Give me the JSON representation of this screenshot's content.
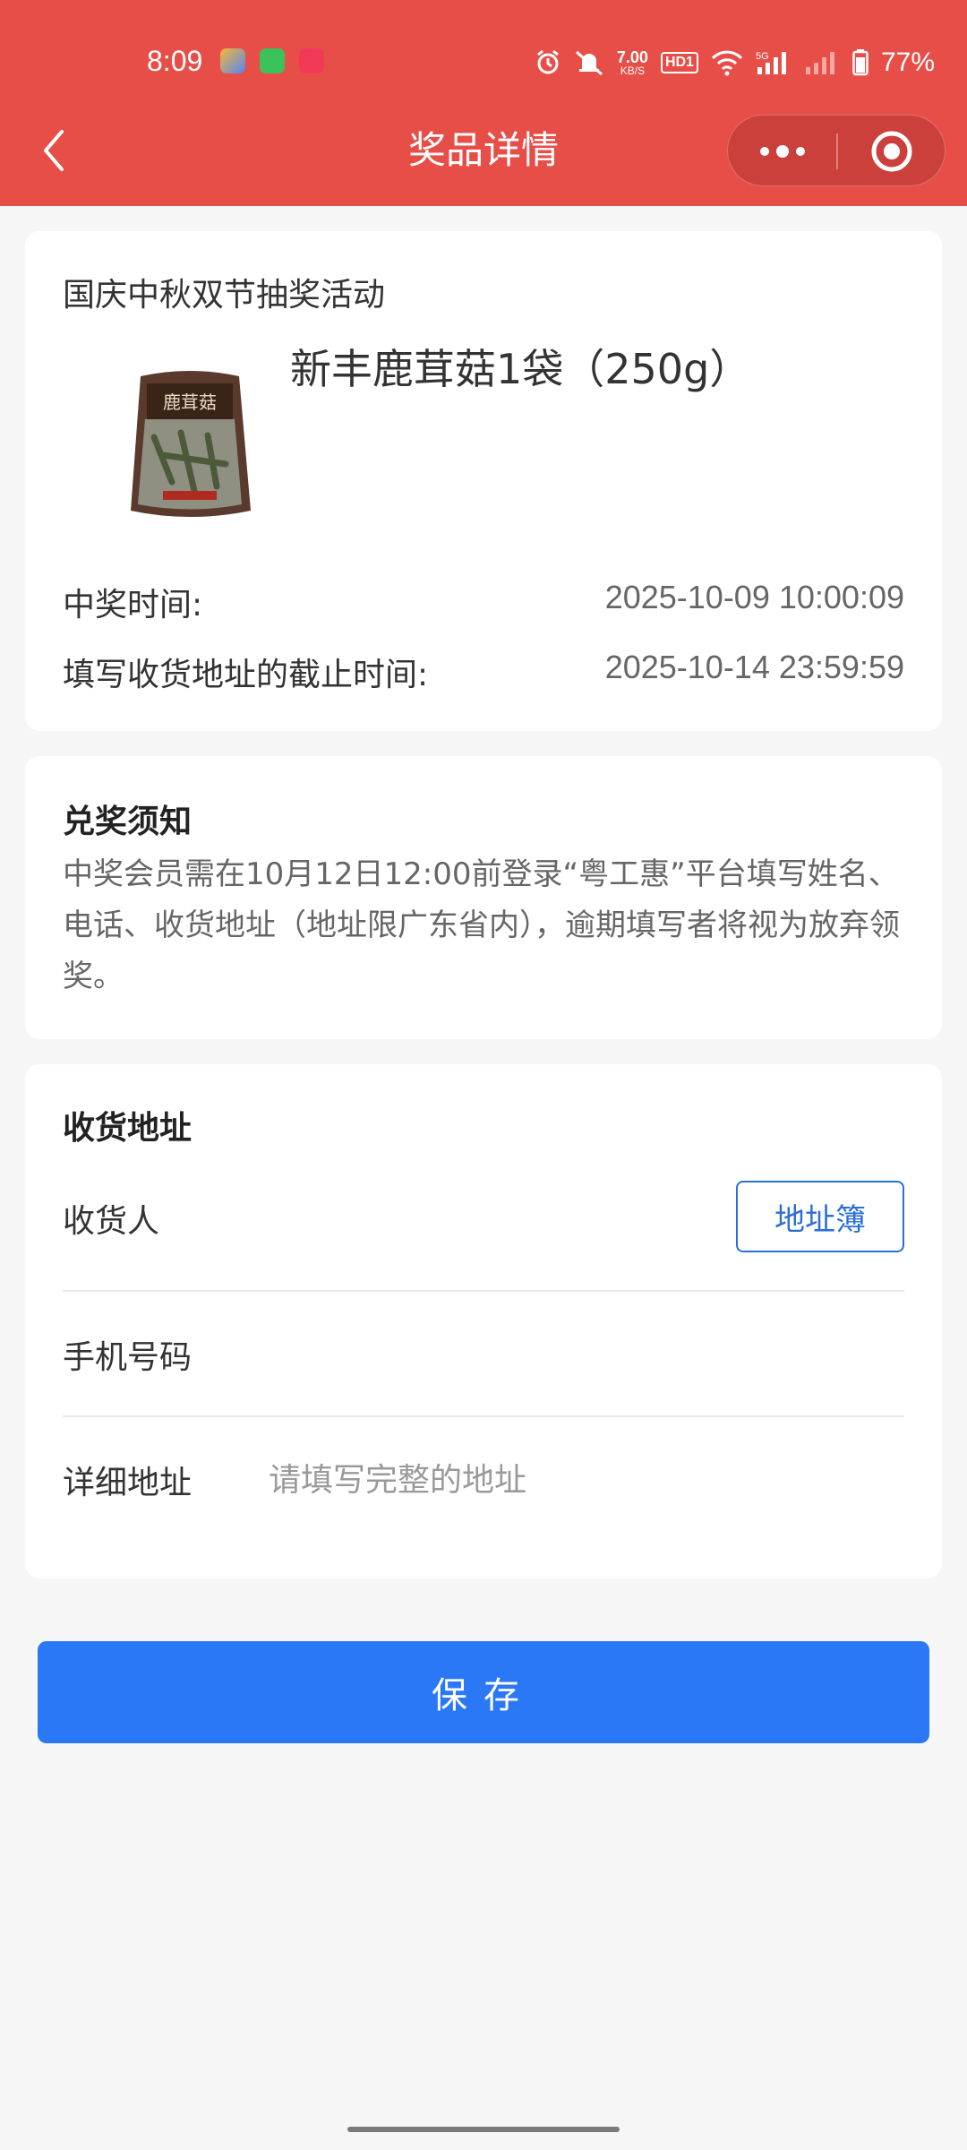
{
  "status_bar": {
    "time": "8:09",
    "net_speed_value": "7.00",
    "net_speed_unit": "KB/S",
    "hd_label": "HD1",
    "signal_label": "5G",
    "battery": "77%"
  },
  "nav": {
    "title": "奖品详情"
  },
  "prize": {
    "activity": "国庆中秋双节抽奖活动",
    "name": "新丰鹿茸菇1袋（250g）",
    "win_time_label": "中奖时间:",
    "win_time": "2025-10-09 10:00:09",
    "deadline_label": "填写收货地址的截止时间:",
    "deadline": "2025-10-14 23:59:59"
  },
  "notice": {
    "title": "兑奖须知",
    "text": "中奖会员需在10月12日12:00前登录“粤工惠”平台填写姓名、电话、收货地址（地址限广东省内），逾期填写者将视为放弃领奖。"
  },
  "address": {
    "title": "收货地址",
    "receiver_label": "收货人",
    "receiver_value": "",
    "address_book_label": "地址簿",
    "phone_label": "手机号码",
    "phone_value": "",
    "detail_label": "详细地址",
    "detail_placeholder": "请填写完整的地址"
  },
  "save_label": "保存",
  "colors": {
    "header": "#e84e48",
    "primary": "#2b78f6",
    "link": "#2a6fd6"
  }
}
